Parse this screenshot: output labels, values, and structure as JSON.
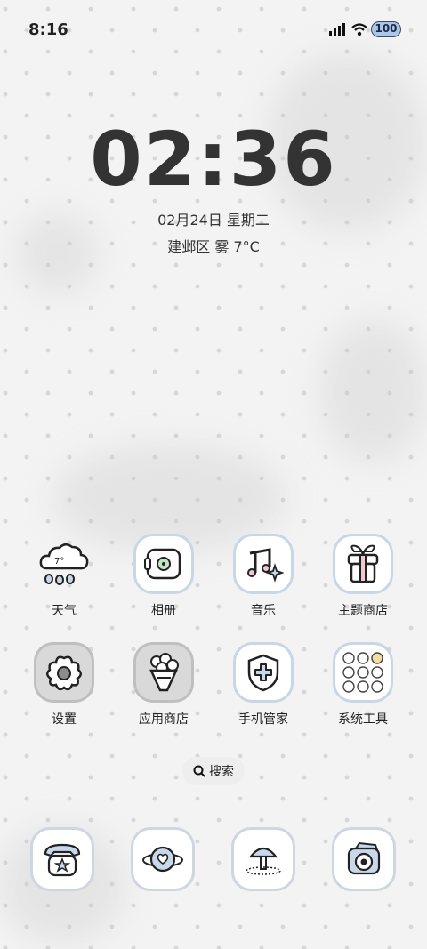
{
  "status_bar": {
    "time": "8:16",
    "battery": "100",
    "icons": [
      "signal-icon",
      "wifi-icon",
      "battery-icon"
    ]
  },
  "lockclock": {
    "time": "02:36",
    "date": "02月24日 星期二",
    "weather": "建邺区 雾 7°C"
  },
  "weather_icon_temp": "7°",
  "apps_row1": [
    {
      "label": "天气",
      "icon": "weather-cloud-icon"
    },
    {
      "label": "相册",
      "icon": "album-icon"
    },
    {
      "label": "音乐",
      "icon": "music-icon"
    },
    {
      "label": "主题商店",
      "icon": "gift-box-icon"
    }
  ],
  "apps_row2": [
    {
      "label": "设置",
      "icon": "flower-settings-icon"
    },
    {
      "label": "应用商店",
      "icon": "bouquet-icon"
    },
    {
      "label": "手机管家",
      "icon": "shield-icon"
    },
    {
      "label": "系统工具",
      "icon": "tools-folder-icon"
    }
  ],
  "search": {
    "label": "搜索"
  },
  "dock": [
    {
      "icon": "phone-icon"
    },
    {
      "icon": "planet-messages-icon"
    },
    {
      "icon": "mushroom-browser-icon"
    },
    {
      "icon": "camera-icon"
    }
  ]
}
